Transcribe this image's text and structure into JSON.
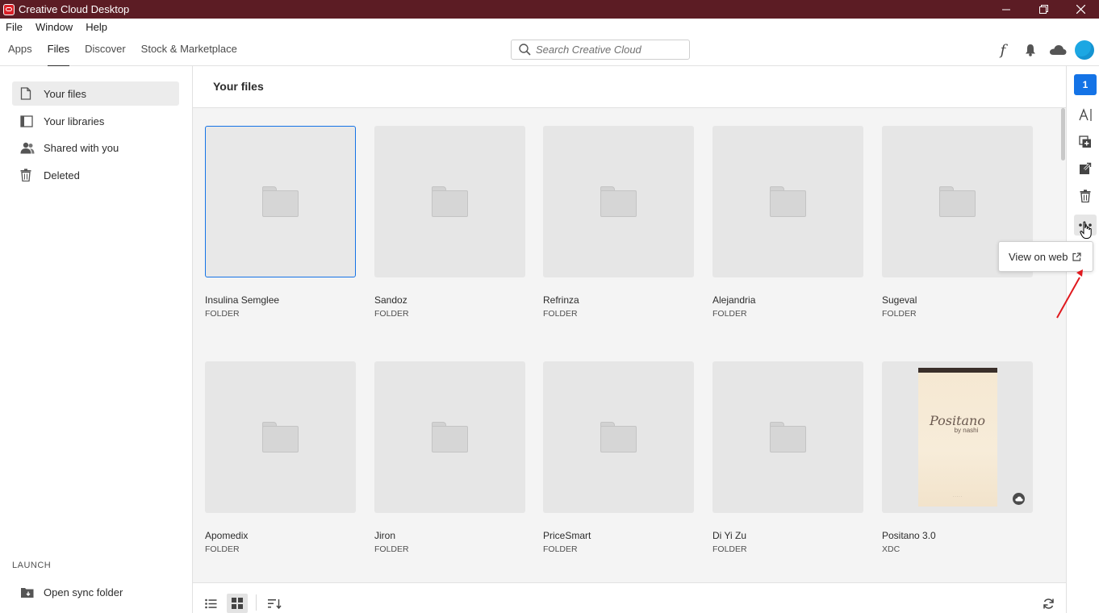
{
  "window": {
    "title": "Creative Cloud Desktop"
  },
  "menu": [
    "File",
    "Window",
    "Help"
  ],
  "nav": {
    "tabs": [
      "Apps",
      "Files",
      "Discover",
      "Stock & Marketplace"
    ],
    "active_tab": "Files",
    "search_placeholder": "Search Creative Cloud",
    "icons": [
      "font-icon",
      "bell-icon",
      "cloud-icon",
      "avatar"
    ]
  },
  "sidebar": {
    "items": [
      {
        "label": "Your files",
        "icon": "files-icon",
        "active": true
      },
      {
        "label": "Your libraries",
        "icon": "libraries-icon",
        "active": false
      },
      {
        "label": "Shared with you",
        "icon": "people-icon",
        "active": false
      },
      {
        "label": "Deleted",
        "icon": "trash-icon",
        "active": false
      }
    ],
    "launch_label": "LAUNCH",
    "launch_item": "Open sync folder"
  },
  "main": {
    "heading": "Your files",
    "files": [
      {
        "name": "Insulina Semglee",
        "type": "FOLDER",
        "selected": true
      },
      {
        "name": "Sandoz",
        "type": "FOLDER"
      },
      {
        "name": "Refrinza",
        "type": "FOLDER"
      },
      {
        "name": "Alejandria",
        "type": "FOLDER"
      },
      {
        "name": "Sugeval",
        "type": "FOLDER"
      },
      {
        "name": "Apomedix",
        "type": "FOLDER"
      },
      {
        "name": "Jiron",
        "type": "FOLDER"
      },
      {
        "name": "PriceSmart",
        "type": "FOLDER"
      },
      {
        "name": "Di Yi Zu",
        "type": "FOLDER"
      },
      {
        "name": "Positano 3.0",
        "type": "XDC"
      }
    ],
    "xd_preview": {
      "title": "Positano",
      "subtitle": "by nashi"
    }
  },
  "rail": {
    "selection_count": "1"
  },
  "popup": {
    "label": "View on web"
  },
  "colors": {
    "titlebar": "#5c1c24",
    "accent": "#1473e6",
    "annotation_arrow": "#e0191e"
  }
}
